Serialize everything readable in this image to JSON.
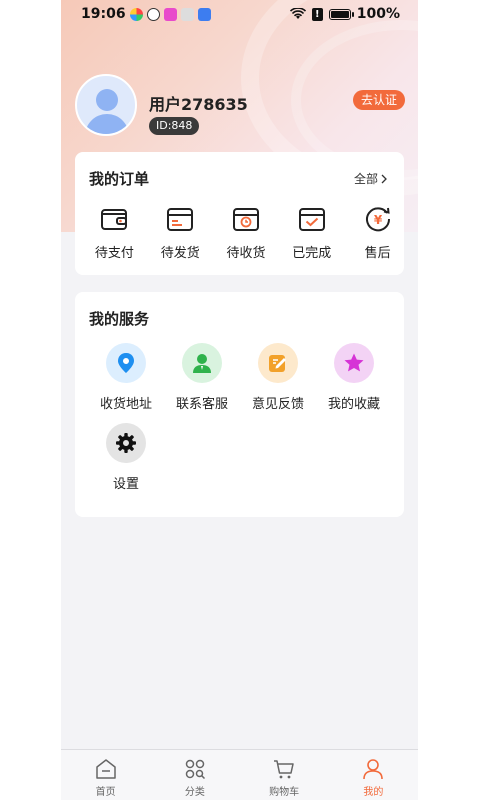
{
  "status_bar": {
    "time": "19:06",
    "battery": "100%",
    "alert": "!"
  },
  "profile": {
    "username": "用户278635",
    "id_label": "ID:848",
    "verify_label": "去认证"
  },
  "orders": {
    "title": "我的订单",
    "all_label": "全部",
    "items": [
      {
        "label": "待支付",
        "icon": "wallet-icon"
      },
      {
        "label": "待发货",
        "icon": "box-icon"
      },
      {
        "label": "待收货",
        "icon": "clock-box-icon"
      },
      {
        "label": "已完成",
        "icon": "check-box-icon"
      },
      {
        "label": "售后",
        "icon": "yen-refund-icon"
      }
    ]
  },
  "services": {
    "title": "我的服务",
    "items": [
      {
        "label": "收货地址",
        "icon": "location-pin-icon",
        "color": "#1e8ff0",
        "bg": "#dceefe"
      },
      {
        "label": "联系客服",
        "icon": "customer-service-icon",
        "color": "#2fb24c",
        "bg": "#d9f3df"
      },
      {
        "label": "意见反馈",
        "icon": "feedback-pencil-icon",
        "color": "#f2a12a",
        "bg": "#fde9cc"
      },
      {
        "label": "我的收藏",
        "icon": "star-icon",
        "color": "#d634d6",
        "bg": "#f3d3f5"
      },
      {
        "label": "设置",
        "icon": "gear-icon",
        "color": "#111111",
        "bg": "#e4e4e4"
      }
    ]
  },
  "nav": {
    "items": [
      {
        "label": "首页",
        "icon": "home-icon"
      },
      {
        "label": "分类",
        "icon": "category-icon"
      },
      {
        "label": "购物车",
        "icon": "cart-icon"
      },
      {
        "label": "我的",
        "icon": "user-icon"
      }
    ],
    "active_color": "#f26a3b"
  }
}
